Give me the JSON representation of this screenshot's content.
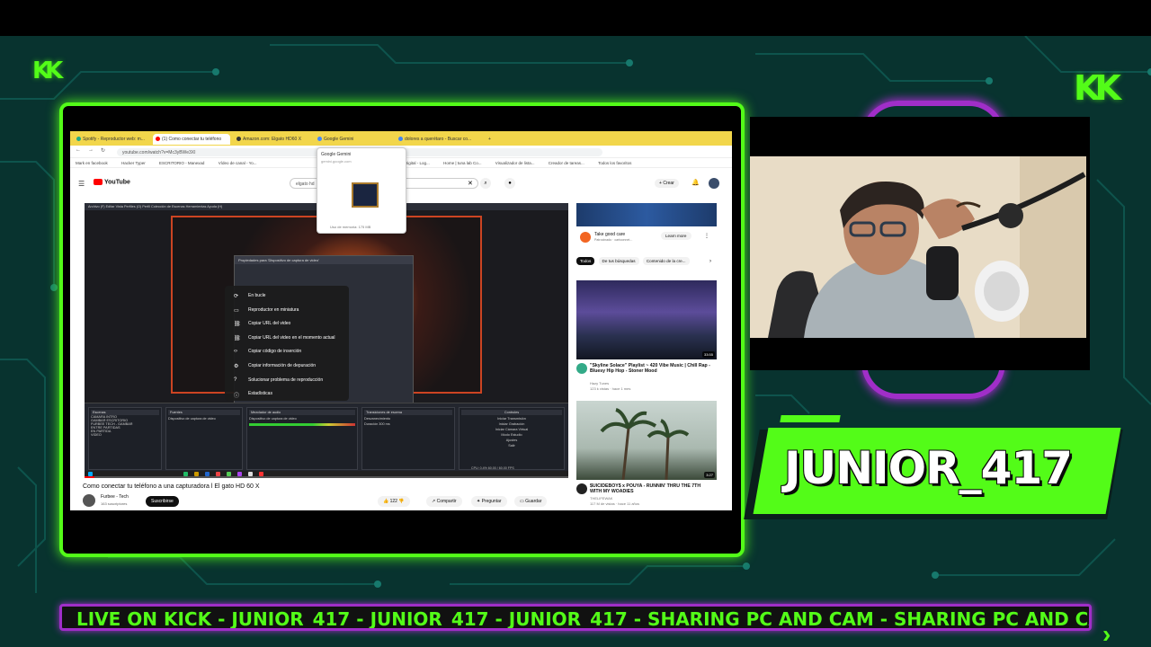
{
  "browser": {
    "tabs": [
      {
        "label": "Spotify - Reproductor web: m..."
      },
      {
        "label": "(1) Como conectar tu teléfono"
      },
      {
        "label": "Amazon.com: Elgato HD60 X"
      },
      {
        "label": "Google Gemini"
      },
      {
        "label": "dolores a querétaro - Buscar co..."
      }
    ],
    "url": "youtube.com/watch?v=Mc3yBWe3XI",
    "bookmarks": [
      "Mark en facebook",
      "Hacker Typer",
      "ESCRITORIO - Manexad",
      "Vídeo de canal - Yo...",
      "Mapa",
      "Fever Digital - Log...",
      "Home | tuna lab Co...",
      "Visualizador de lista...",
      "Creador de tareas...",
      "Todos los favoritos"
    ],
    "popup": {
      "title": "Google Gemini",
      "subtitle": "gemini.google.com",
      "footer": "Uso de memoria: 175 MB"
    }
  },
  "youtube": {
    "logo": "YouTube",
    "search_value": "elgato hd",
    "create_label": "Crear",
    "video_title": "Como conectar tu teléfono a una capturadora l El gato HD 60 X",
    "channel": {
      "name": "Furbee - Tech",
      "subs": "163 suscriptores"
    },
    "subscribe_label": "Suscribirse",
    "actions": {
      "likes": "122",
      "share": "Compartir",
      "ask": "Preguntar",
      "save": "Guardar"
    },
    "progress": 0.02,
    "context_menu": [
      "En bucle",
      "Reproductor en miniatura",
      "Copiar URL del video",
      "Copiar URL del video en el momento actual",
      "Copiar código de inserción",
      "Copiar información de depuración",
      "Solucionar problema de reproducción",
      "Estadísticas"
    ],
    "obs": {
      "menu": "Archivo (F)  Editar  Vista  Perfiles (O)  Perfil  Colección de Escenas  Herramientas  Ayuda (H)",
      "dialog_title": "Propiedades para 'Dispositivo de captura de video'",
      "docks": {
        "scenes": {
          "title": "Escenas",
          "items": [
            "CAMARA INTRO",
            "GAMBAR ESCRITORIO",
            "FURBEE TECH - GAMBAR",
            "ENTRE PARTIDAS",
            "EN PARTIDA",
            "VIDEO"
          ]
        },
        "sources": {
          "title": "Fuentes",
          "items": [
            "Dispositivo de captura de video"
          ]
        },
        "mixer": {
          "title": "Mezclador de audio",
          "items": [
            "Dispositivo de captura de video"
          ]
        },
        "transitions": {
          "title": "Transiciones de escena",
          "items": [
            "Desvanecimiento",
            "Duración  300 ms"
          ]
        },
        "controls": {
          "title": "Controles",
          "items": [
            "Iniciar Transmisión",
            "Iniciar Grabación",
            "Iniciar Cámara Virtual",
            "Modo Estudio",
            "Ajustes",
            "Salir"
          ]
        }
      },
      "status": "CPU: 0.4%   60.00 / 60.00 FPS"
    }
  },
  "sidebar": {
    "ad": {
      "title": "Take good care",
      "sub": "Patrocinado · cartoonnet...",
      "cta": "Learn more"
    },
    "chips": [
      "Todos",
      "De tus búsquedas",
      "Contenido de la cre..."
    ],
    "recs": [
      {
        "title": "\"Skyline Solace\" Playlist ~ 420 Vibe Music | Chill Rap - Bluesy Hip Hop - Stoner Mood",
        "channel": "Hazy Tunes",
        "stats": "123 k vistas · hace 1 mes",
        "duration": "33:55"
      },
      {
        "title": "$UICIDEBOY$ x POUYA - RUNNIN' THRU THE 7TH WITH MY WOADIES",
        "channel": "THELIFEWAK",
        "stats": "117 M de vistas · hace 11 años",
        "duration": "3:27"
      }
    ]
  },
  "overlay": {
    "streamer_name": "JUNIOR_417",
    "ticker": "LIVE ON KICK - JUNIOR_417 - JUNIOR_417 - JUNIOR_417 - SHARING PC AND CAM - SHARING PC AND CAM",
    "accent": "#53fc18",
    "secondary": "#a02ec8"
  }
}
